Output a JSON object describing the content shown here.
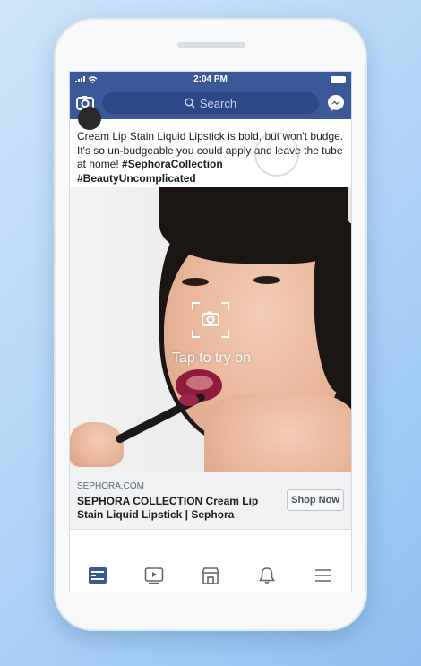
{
  "status_bar": {
    "time": "2:04 PM"
  },
  "navbar": {
    "search_placeholder": "Search",
    "icons": [
      "camera-icon",
      "search-icon",
      "messenger-icon"
    ]
  },
  "post": {
    "text_plain": "Cream Lip Stain Liquid Lipstick is bold, but won't budge. It's so un-budgeable you could apply and leave the tube at home! ",
    "hashtag_1": "#SephoraCollection",
    "hashtag_2": "#BeautyUncomplicated"
  },
  "ad": {
    "overlay_text": "Tap to try on",
    "domain": "SEPHORA.COM",
    "title": "SEPHORA COLLECTION Cream Lip Stain Liquid Lipstick | Sephora",
    "cta_label": "Shop Now"
  },
  "tabs": [
    "news-feed-icon",
    "video-icon",
    "marketplace-icon",
    "notifications-icon",
    "menu-icon"
  ],
  "colors": {
    "brand": "#3b5998",
    "search_bg": "#2d4887",
    "lip": "#8e1c3a",
    "background": "#b4d6f6"
  }
}
